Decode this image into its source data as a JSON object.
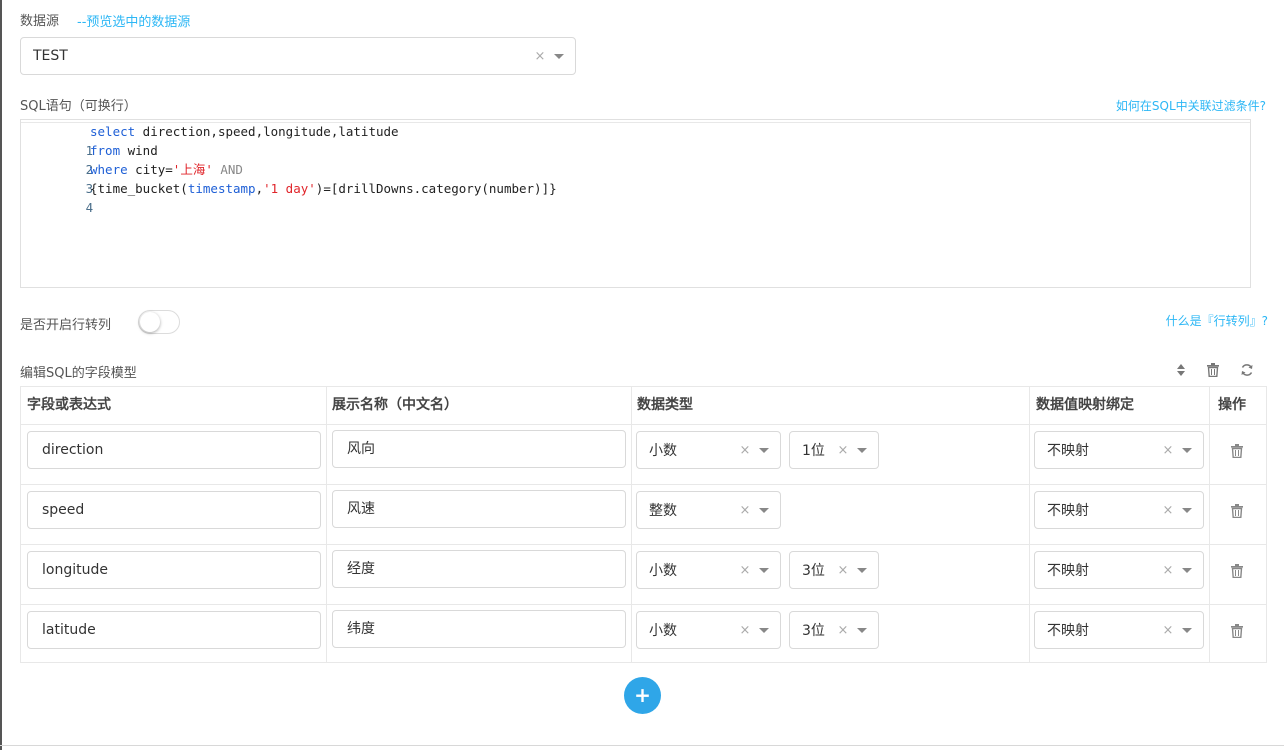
{
  "datasource": {
    "label": "数据源",
    "preview_link": "--预览选中的数据源",
    "selected": "TEST",
    "clear": "×"
  },
  "sql": {
    "label": "SQL语句（可换行）",
    "help_link": "如何在SQL中关联过滤条件?",
    "lines": [
      {
        "num": "1"
      },
      {
        "num": "2"
      },
      {
        "num": "3"
      },
      {
        "num": "4"
      }
    ],
    "tokens": {
      "l1_kw": "select",
      "l1_rest": " direction,speed,longitude,latitude",
      "l2_kw": "from",
      "l2_rest": " wind",
      "l3_kw": "where",
      "l3_a": " city=",
      "l3_str": "'上海'",
      "l3_and": " AND",
      "l4_a": "{time_bucket(",
      "l4_fn": "timestamp",
      "l4_b": ",",
      "l4_str": "'1 day'",
      "l4_c": ")=[drillDowns.category(number)]}"
    }
  },
  "pivot": {
    "label": "是否开启行转列",
    "enabled": false,
    "help_link": "什么是『行转列』?"
  },
  "field_model": {
    "label": "编辑SQL的字段模型",
    "icons": [
      "sort-icon",
      "trash-icon",
      "refresh-icon"
    ],
    "columns": [
      "字段或表达式",
      "展示名称（中文名）",
      "数据类型",
      "数据值映射绑定",
      "操作"
    ],
    "rows": [
      {
        "field": "direction",
        "display": "风向",
        "type": "小数",
        "precision": "1位",
        "mapping": "不映射"
      },
      {
        "field": "speed",
        "display": "风速",
        "type": "整数",
        "precision": "",
        "mapping": "不映射"
      },
      {
        "field": "longitude",
        "display": "经度",
        "type": "小数",
        "precision": "3位",
        "mapping": "不映射"
      },
      {
        "field": "latitude",
        "display": "纬度",
        "type": "小数",
        "precision": "3位",
        "mapping": "不映射"
      }
    ],
    "clear": "×",
    "add_label": "+"
  },
  "colors": {
    "accent": "#2db7f5",
    "add_button": "#2fa6e8",
    "keyword": "#1e5fd6",
    "string": "#e0242a"
  }
}
